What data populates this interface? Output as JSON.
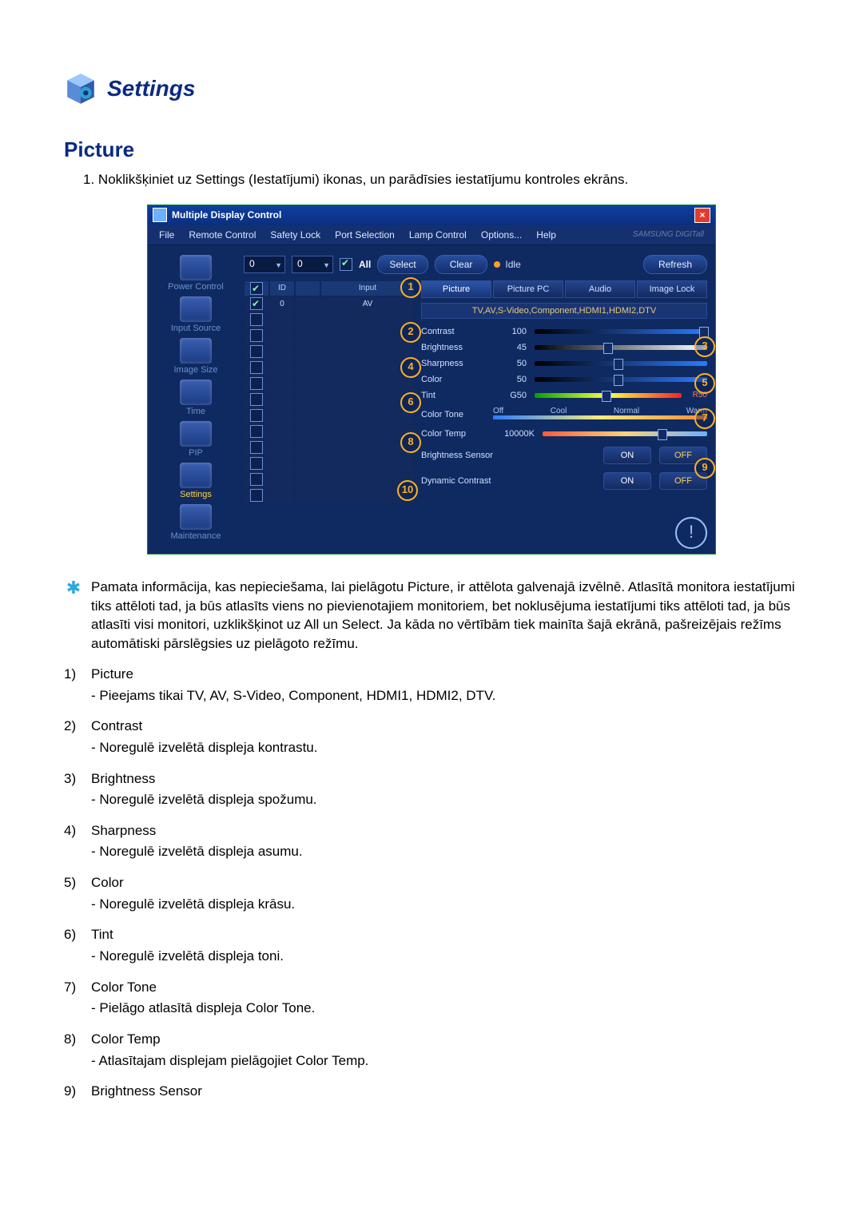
{
  "doc": {
    "heading": "Settings",
    "subheading": "Picture",
    "intro_num": "1.",
    "intro": "Noklikšķiniet uz Settings (Iestatījumi) ikonas, un parādīsies iestatījumu kontroles ekrāns."
  },
  "note": {
    "star": "✱",
    "text": "Pamata informācija, kas nepieciešama, lai pielāgotu Picture, ir attēlota galvenajā izvēlnē. Atlasītā monitora iestatījumi tiks attēloti tad, ja būs atlasīts viens no pievienotajiem monitoriem, bet noklusējuma iestatījumi tiks attēloti tad, ja būs atlasīti visi monitori, uzklikšķinot uz All un Select. Ja kāda no vērtībām tiek mainīta šajā ekrānā, pašreizējais režīms automātiski pārslēgsies uz pielāgoto režīmu."
  },
  "items": [
    {
      "n": "1)",
      "t": "Picture",
      "d": "- Pieejams tikai TV, AV, S-Video, Component, HDMI1, HDMI2, DTV."
    },
    {
      "n": "2)",
      "t": "Contrast",
      "d": "- Noregulē izvelētā displeja kontrastu."
    },
    {
      "n": "3)",
      "t": "Brightness",
      "d": "- Noregulē izvelētā displeja spožumu."
    },
    {
      "n": "4)",
      "t": "Sharpness",
      "d": "- Noregulē izvelētā displeja asumu."
    },
    {
      "n": "5)",
      "t": "Color",
      "d": "- Noregulē izvelētā displeja krāsu."
    },
    {
      "n": "6)",
      "t": "Tint",
      "d": "- Noregulē izvelētā displeja toni."
    },
    {
      "n": "7)",
      "t": "Color Tone",
      "d": "- Pielāgo atlasītā displeja Color Tone."
    },
    {
      "n": "8)",
      "t": "Color Temp",
      "d": "- Atlasītajam displejam pielāgojiet Color Temp."
    },
    {
      "n": "9)",
      "t": "Brightness Sensor",
      "d": ""
    }
  ],
  "app": {
    "title": "Multiple Display Control",
    "brand": "SAMSUNG DIGITall",
    "menus": [
      "File",
      "Remote Control",
      "Safety Lock",
      "Port Selection",
      "Lamp Control",
      "Options...",
      "Help"
    ],
    "toolbar": {
      "sel1": "0",
      "sel2": "0",
      "all": "All",
      "select": "Select",
      "clear": "Clear",
      "idle": "Idle",
      "refresh": "Refresh"
    },
    "sidebar": [
      "Power Control",
      "Input Source",
      "Image Size",
      "Time",
      "PIP",
      "Settings",
      "Maintenance"
    ],
    "grid": {
      "hdr": {
        "id": "ID",
        "input": "Input"
      },
      "row": {
        "id": "0",
        "input": "AV"
      }
    },
    "tabs": [
      "Picture",
      "Picture PC",
      "Audio",
      "Image Lock"
    ],
    "tabnote": "TV,AV,S-Video,Component,HDMI1,HDMI2,DTV",
    "sliders": {
      "contrast": {
        "l": "Contrast",
        "v": "100"
      },
      "brightness": {
        "l": "Brightness",
        "v": "45"
      },
      "sharpness": {
        "l": "Sharpness",
        "v": "50"
      },
      "color": {
        "l": "Color",
        "v": "50"
      },
      "tint": {
        "l": "Tint",
        "v": "G50",
        "r": "R50"
      },
      "colortone": {
        "l": "Color Tone",
        "opts": [
          "Off",
          "Cool",
          "Normal",
          "Warm"
        ]
      },
      "colortemp": {
        "l": "Color Temp",
        "v": "10000K"
      },
      "bsensor": {
        "l": "Brightness Sensor",
        "on": "ON",
        "off": "OFF"
      },
      "dcontrast": {
        "l": "Dynamic Contrast",
        "on": "ON",
        "off": "OFF"
      }
    },
    "callouts": {
      "1": "1",
      "2": "2",
      "3": "3",
      "4": "4",
      "5": "5",
      "6": "6",
      "7": "7",
      "8": "8",
      "9": "9",
      "10": "10"
    }
  }
}
